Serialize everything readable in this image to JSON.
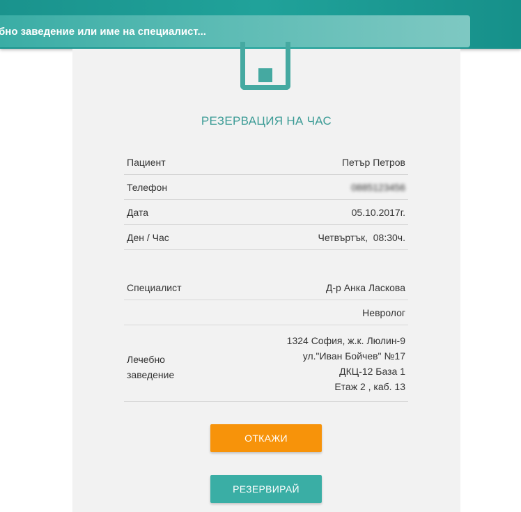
{
  "header": {
    "search_placeholder": "бно заведение или име на специалист..."
  },
  "card": {
    "title": "РЕЗЕРВАЦИЯ НА ЧАС",
    "rows": [
      {
        "label": "Пациент",
        "value": "Петър Петров"
      },
      {
        "label": "Телефон",
        "value": "0885123456"
      },
      {
        "label": "Дата",
        "value": "05.10.2017г."
      },
      {
        "label": "Ден / Час",
        "value": "Четвъртък,  08:30ч."
      }
    ],
    "specialist": {
      "label": "Специалист",
      "name": "Д-р Анка Ласкова",
      "specialty": "Невролог"
    },
    "facility": {
      "label_line1": "Лечебно",
      "label_line2": "заведение",
      "address_line1": "1324 София, ж.к. Люлин-9",
      "address_line2": "ул.\"Иван Бойчев\" №17",
      "address_line3": "ДКЦ-12 База 1",
      "address_line4": "Етаж 2 , каб. 13"
    },
    "buttons": {
      "cancel_label": "ОТКАЖИ",
      "reserve_label": "РЕЗЕРВИРАЙ"
    }
  },
  "colors": {
    "teal": "#20a29a",
    "orange": "#f7930a",
    "button_teal": "#3aaea5"
  }
}
